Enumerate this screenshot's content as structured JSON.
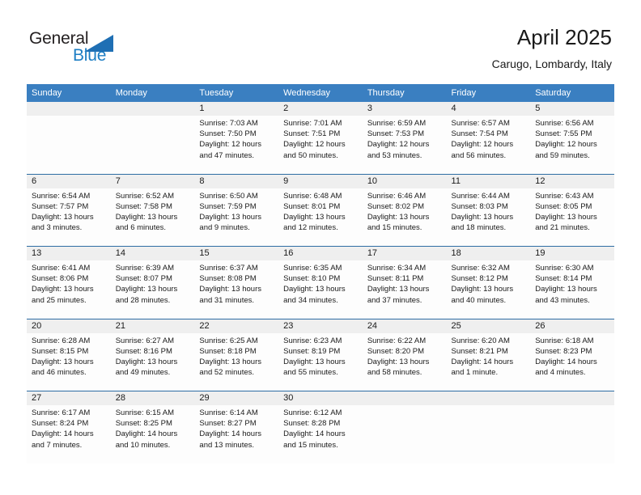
{
  "brand": {
    "name_part1": "General",
    "name_part2": "Blue",
    "triangle_icon": "triangle-logo-icon",
    "accent_color": "#1f6fb4"
  },
  "header": {
    "title": "April 2025",
    "subtitle": "Carugo, Lombardy, Italy"
  },
  "theme": {
    "header_bg": "#3a7fc1",
    "daynum_bg": "#efefef",
    "separator": "#2e6da4",
    "cell_bg": "#fdfdfd"
  },
  "weekday_headers": [
    "Sunday",
    "Monday",
    "Tuesday",
    "Wednesday",
    "Thursday",
    "Friday",
    "Saturday"
  ],
  "weeks": [
    {
      "days": [
        {
          "num": "",
          "sunrise": "",
          "sunset": "",
          "daylight_1": "",
          "daylight_2": ""
        },
        {
          "num": "",
          "sunrise": "",
          "sunset": "",
          "daylight_1": "",
          "daylight_2": ""
        },
        {
          "num": "1",
          "sunrise": "Sunrise: 7:03 AM",
          "sunset": "Sunset: 7:50 PM",
          "daylight_1": "Daylight: 12 hours",
          "daylight_2": "and 47 minutes."
        },
        {
          "num": "2",
          "sunrise": "Sunrise: 7:01 AM",
          "sunset": "Sunset: 7:51 PM",
          "daylight_1": "Daylight: 12 hours",
          "daylight_2": "and 50 minutes."
        },
        {
          "num": "3",
          "sunrise": "Sunrise: 6:59 AM",
          "sunset": "Sunset: 7:53 PM",
          "daylight_1": "Daylight: 12 hours",
          "daylight_2": "and 53 minutes."
        },
        {
          "num": "4",
          "sunrise": "Sunrise: 6:57 AM",
          "sunset": "Sunset: 7:54 PM",
          "daylight_1": "Daylight: 12 hours",
          "daylight_2": "and 56 minutes."
        },
        {
          "num": "5",
          "sunrise": "Sunrise: 6:56 AM",
          "sunset": "Sunset: 7:55 PM",
          "daylight_1": "Daylight: 12 hours",
          "daylight_2": "and 59 minutes."
        }
      ]
    },
    {
      "days": [
        {
          "num": "6",
          "sunrise": "Sunrise: 6:54 AM",
          "sunset": "Sunset: 7:57 PM",
          "daylight_1": "Daylight: 13 hours",
          "daylight_2": "and 3 minutes."
        },
        {
          "num": "7",
          "sunrise": "Sunrise: 6:52 AM",
          "sunset": "Sunset: 7:58 PM",
          "daylight_1": "Daylight: 13 hours",
          "daylight_2": "and 6 minutes."
        },
        {
          "num": "8",
          "sunrise": "Sunrise: 6:50 AM",
          "sunset": "Sunset: 7:59 PM",
          "daylight_1": "Daylight: 13 hours",
          "daylight_2": "and 9 minutes."
        },
        {
          "num": "9",
          "sunrise": "Sunrise: 6:48 AM",
          "sunset": "Sunset: 8:01 PM",
          "daylight_1": "Daylight: 13 hours",
          "daylight_2": "and 12 minutes."
        },
        {
          "num": "10",
          "sunrise": "Sunrise: 6:46 AM",
          "sunset": "Sunset: 8:02 PM",
          "daylight_1": "Daylight: 13 hours",
          "daylight_2": "and 15 minutes."
        },
        {
          "num": "11",
          "sunrise": "Sunrise: 6:44 AM",
          "sunset": "Sunset: 8:03 PM",
          "daylight_1": "Daylight: 13 hours",
          "daylight_2": "and 18 minutes."
        },
        {
          "num": "12",
          "sunrise": "Sunrise: 6:43 AM",
          "sunset": "Sunset: 8:05 PM",
          "daylight_1": "Daylight: 13 hours",
          "daylight_2": "and 21 minutes."
        }
      ]
    },
    {
      "days": [
        {
          "num": "13",
          "sunrise": "Sunrise: 6:41 AM",
          "sunset": "Sunset: 8:06 PM",
          "daylight_1": "Daylight: 13 hours",
          "daylight_2": "and 25 minutes."
        },
        {
          "num": "14",
          "sunrise": "Sunrise: 6:39 AM",
          "sunset": "Sunset: 8:07 PM",
          "daylight_1": "Daylight: 13 hours",
          "daylight_2": "and 28 minutes."
        },
        {
          "num": "15",
          "sunrise": "Sunrise: 6:37 AM",
          "sunset": "Sunset: 8:08 PM",
          "daylight_1": "Daylight: 13 hours",
          "daylight_2": "and 31 minutes."
        },
        {
          "num": "16",
          "sunrise": "Sunrise: 6:35 AM",
          "sunset": "Sunset: 8:10 PM",
          "daylight_1": "Daylight: 13 hours",
          "daylight_2": "and 34 minutes."
        },
        {
          "num": "17",
          "sunrise": "Sunrise: 6:34 AM",
          "sunset": "Sunset: 8:11 PM",
          "daylight_1": "Daylight: 13 hours",
          "daylight_2": "and 37 minutes."
        },
        {
          "num": "18",
          "sunrise": "Sunrise: 6:32 AM",
          "sunset": "Sunset: 8:12 PM",
          "daylight_1": "Daylight: 13 hours",
          "daylight_2": "and 40 minutes."
        },
        {
          "num": "19",
          "sunrise": "Sunrise: 6:30 AM",
          "sunset": "Sunset: 8:14 PM",
          "daylight_1": "Daylight: 13 hours",
          "daylight_2": "and 43 minutes."
        }
      ]
    },
    {
      "days": [
        {
          "num": "20",
          "sunrise": "Sunrise: 6:28 AM",
          "sunset": "Sunset: 8:15 PM",
          "daylight_1": "Daylight: 13 hours",
          "daylight_2": "and 46 minutes."
        },
        {
          "num": "21",
          "sunrise": "Sunrise: 6:27 AM",
          "sunset": "Sunset: 8:16 PM",
          "daylight_1": "Daylight: 13 hours",
          "daylight_2": "and 49 minutes."
        },
        {
          "num": "22",
          "sunrise": "Sunrise: 6:25 AM",
          "sunset": "Sunset: 8:18 PM",
          "daylight_1": "Daylight: 13 hours",
          "daylight_2": "and 52 minutes."
        },
        {
          "num": "23",
          "sunrise": "Sunrise: 6:23 AM",
          "sunset": "Sunset: 8:19 PM",
          "daylight_1": "Daylight: 13 hours",
          "daylight_2": "and 55 minutes."
        },
        {
          "num": "24",
          "sunrise": "Sunrise: 6:22 AM",
          "sunset": "Sunset: 8:20 PM",
          "daylight_1": "Daylight: 13 hours",
          "daylight_2": "and 58 minutes."
        },
        {
          "num": "25",
          "sunrise": "Sunrise: 6:20 AM",
          "sunset": "Sunset: 8:21 PM",
          "daylight_1": "Daylight: 14 hours",
          "daylight_2": "and 1 minute."
        },
        {
          "num": "26",
          "sunrise": "Sunrise: 6:18 AM",
          "sunset": "Sunset: 8:23 PM",
          "daylight_1": "Daylight: 14 hours",
          "daylight_2": "and 4 minutes."
        }
      ]
    },
    {
      "days": [
        {
          "num": "27",
          "sunrise": "Sunrise: 6:17 AM",
          "sunset": "Sunset: 8:24 PM",
          "daylight_1": "Daylight: 14 hours",
          "daylight_2": "and 7 minutes."
        },
        {
          "num": "28",
          "sunrise": "Sunrise: 6:15 AM",
          "sunset": "Sunset: 8:25 PM",
          "daylight_1": "Daylight: 14 hours",
          "daylight_2": "and 10 minutes."
        },
        {
          "num": "29",
          "sunrise": "Sunrise: 6:14 AM",
          "sunset": "Sunset: 8:27 PM",
          "daylight_1": "Daylight: 14 hours",
          "daylight_2": "and 13 minutes."
        },
        {
          "num": "30",
          "sunrise": "Sunrise: 6:12 AM",
          "sunset": "Sunset: 8:28 PM",
          "daylight_1": "Daylight: 14 hours",
          "daylight_2": "and 15 minutes."
        },
        {
          "num": "",
          "sunrise": "",
          "sunset": "",
          "daylight_1": "",
          "daylight_2": ""
        },
        {
          "num": "",
          "sunrise": "",
          "sunset": "",
          "daylight_1": "",
          "daylight_2": ""
        },
        {
          "num": "",
          "sunrise": "",
          "sunset": "",
          "daylight_1": "",
          "daylight_2": ""
        }
      ]
    }
  ]
}
